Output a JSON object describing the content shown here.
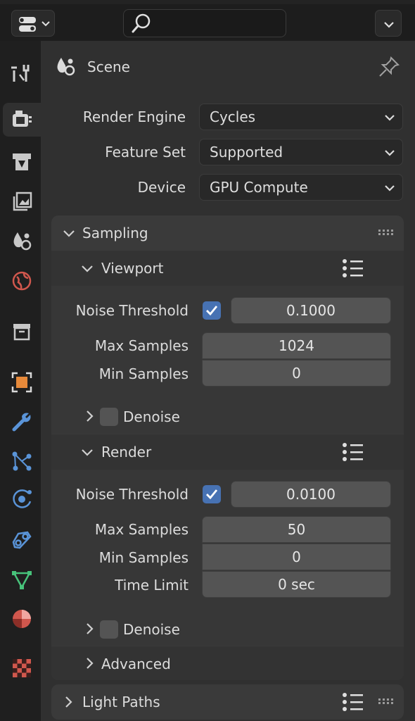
{
  "properties": {
    "context_title": "Scene",
    "render_engine": {
      "label": "Render Engine",
      "value": "Cycles"
    },
    "feature_set": {
      "label": "Feature Set",
      "value": "Supported"
    },
    "device": {
      "label": "Device",
      "value": "GPU Compute"
    }
  },
  "sampling": {
    "title": "Sampling",
    "viewport": {
      "title": "Viewport",
      "noise_threshold": {
        "label": "Noise Threshold",
        "enabled": true,
        "value": "0.1000"
      },
      "max_samples": {
        "label": "Max Samples",
        "value": "1024"
      },
      "min_samples": {
        "label": "Min Samples",
        "value": "0"
      },
      "denoise": {
        "label": "Denoise",
        "enabled": false
      }
    },
    "render": {
      "title": "Render",
      "noise_threshold": {
        "label": "Noise Threshold",
        "enabled": true,
        "value": "0.0100"
      },
      "max_samples": {
        "label": "Max Samples",
        "value": "50"
      },
      "min_samples": {
        "label": "Min Samples",
        "value": "0"
      },
      "time_limit": {
        "label": "Time Limit",
        "value": "0 sec"
      },
      "denoise": {
        "label": "Denoise",
        "enabled": false
      }
    },
    "advanced": {
      "title": "Advanced"
    }
  },
  "light_paths": {
    "title": "Light Paths"
  },
  "tabs": [
    "tool",
    "render",
    "output",
    "view-layer",
    "scene",
    "world",
    "collection",
    "object",
    "modifiers",
    "particles",
    "physics",
    "constraints",
    "data",
    "material",
    "texture"
  ],
  "colors": {
    "accent": "#4772b3",
    "panel": "#3a3a3a",
    "field": "#545454"
  }
}
